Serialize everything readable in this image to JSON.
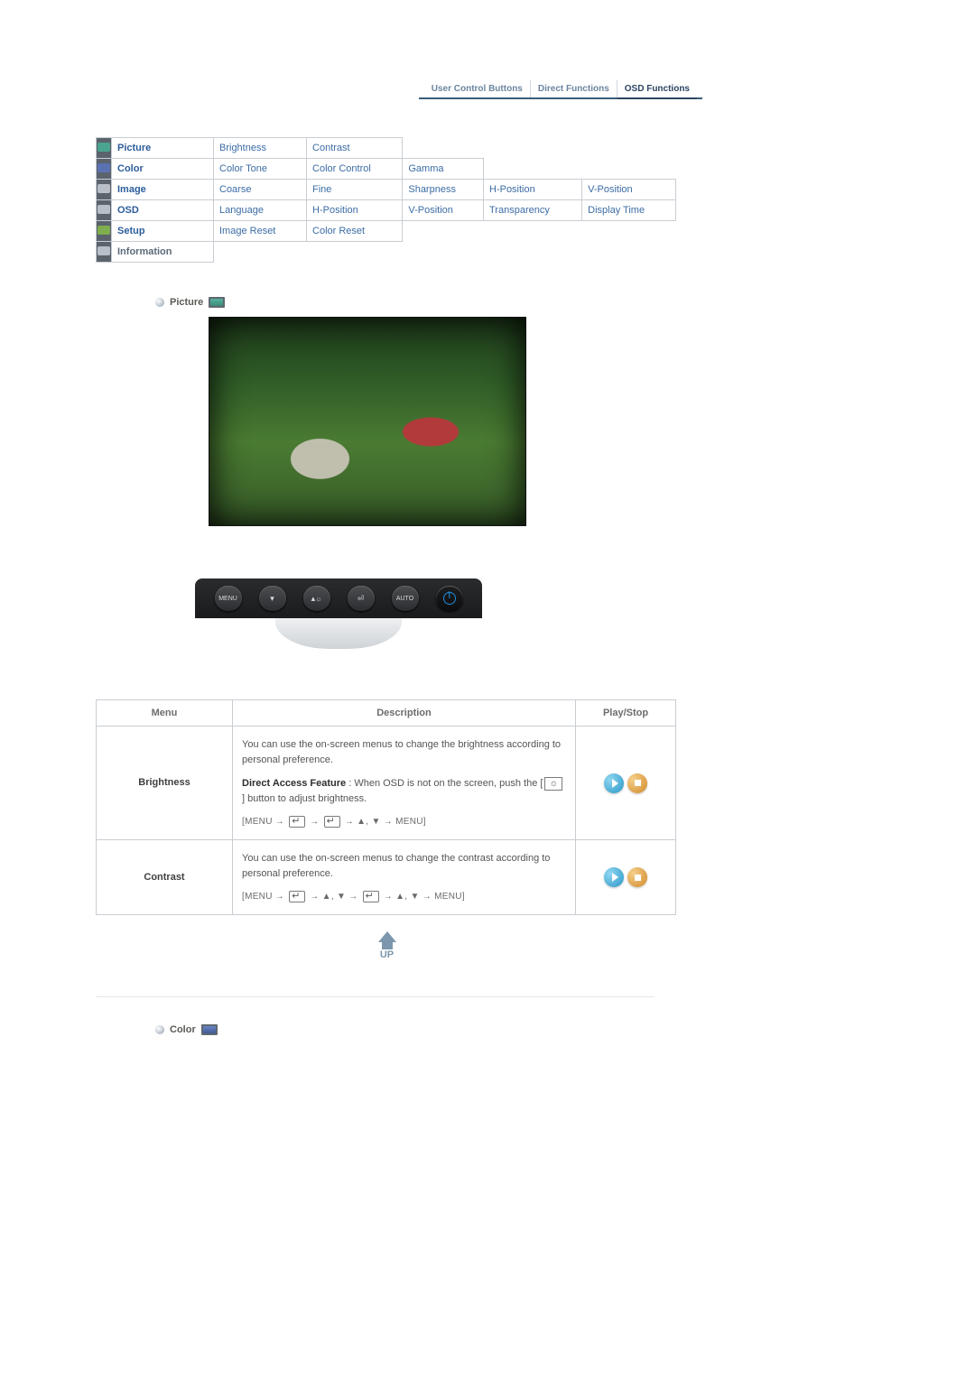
{
  "tabs": {
    "t1": "User Control Buttons",
    "t2": "Direct Functions",
    "t3": "OSD Functions"
  },
  "nav": {
    "picture": {
      "label": "Picture",
      "c1": "Brightness",
      "c2": "Contrast",
      "c3": "",
      "c4": "",
      "c5": ""
    },
    "color": {
      "label": "Color",
      "c1": "Color Tone",
      "c2": "Color Control",
      "c3": "Gamma",
      "c4": "",
      "c5": ""
    },
    "image": {
      "label": "Image",
      "c1": "Coarse",
      "c2": "Fine",
      "c3": "Sharpness",
      "c4": "H-Position",
      "c5": "V-Position"
    },
    "osd": {
      "label": "OSD",
      "c1": "Language",
      "c2": "H-Position",
      "c3": "V-Position",
      "c4": "Transparency",
      "c5": "Display Time"
    },
    "setup": {
      "label": "Setup",
      "c1": "Image Reset",
      "c2": "Color Reset",
      "c3": "",
      "c4": "",
      "c5": ""
    },
    "info": {
      "label": "Information",
      "c1": "",
      "c2": "",
      "c3": "",
      "c4": "",
      "c5": ""
    }
  },
  "sections": {
    "picture_title": "Picture",
    "color_title": "Color"
  },
  "buttons_strip": {
    "b1": "MENU",
    "b2": "",
    "b3": "",
    "b4": "⏎",
    "b5": "AUTO",
    "b6": "power"
  },
  "info_headers": {
    "menu": "Menu",
    "desc": "Description",
    "play": "Play/Stop"
  },
  "rows": {
    "brightness": {
      "menu": "Brightness",
      "desc_p1": "You can use the on-screen menus to change the brightness according to personal preference.",
      "daf_label": "Direct Access Feature",
      "daf_text": " : When OSD is not on the screen, push the [",
      "daf_text2": "] button to adjust brightness.",
      "seq_pre": "[MENU → ",
      "seq_mid": " → ",
      "seq_tail": " → ▲, ▼ → MENU]"
    },
    "contrast": {
      "menu": "Contrast",
      "desc_p1": "You can use the on-screen menus to change the contrast according to personal preference.",
      "seq_pre": "[MENU → ",
      "seq_mid1": " → ▲, ▼ → ",
      "seq_tail": " → ▲, ▼ → MENU]"
    }
  },
  "up_label": "UP"
}
